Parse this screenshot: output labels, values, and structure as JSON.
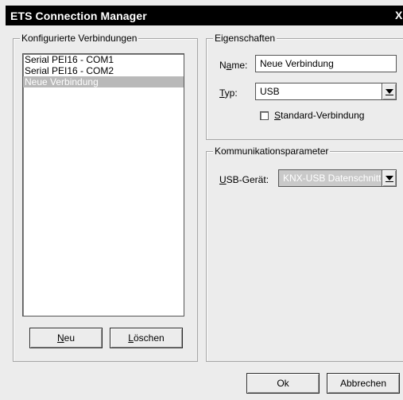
{
  "window": {
    "title": "ETS Connection Manager",
    "close_glyph": "X"
  },
  "connections": {
    "legend": "Konfigurierte Verbindungen",
    "items": [
      {
        "label": "Serial PEI16 - COM1",
        "selected": false
      },
      {
        "label": "Serial PEI16 - COM2",
        "selected": false
      },
      {
        "label": "Neue Verbindung",
        "selected": true
      }
    ],
    "new_button": {
      "pre": "",
      "key": "N",
      "post": "eu"
    },
    "delete_button": {
      "pre": "",
      "key": "L",
      "post": "öschen"
    }
  },
  "properties": {
    "legend": "Eigenschaften",
    "name_label": {
      "pre": "N",
      "key": "a",
      "post": "me:"
    },
    "name_value": "Neue Verbindung",
    "type_label": {
      "pre": "",
      "key": "T",
      "post": "yp:"
    },
    "type_value": "USB",
    "standard_checkbox": {
      "checked": false,
      "label": {
        "pre": "",
        "key": "S",
        "post": "tandard-Verbindung"
      }
    }
  },
  "comm_params": {
    "legend": "Kommunikationsparameter",
    "device_label": {
      "pre": "",
      "key": "U",
      "post": "SB-Gerät:"
    },
    "device_value": "KNX-USB Datenschnittstelle",
    "device_disabled": true
  },
  "footer": {
    "ok_label": "Ok",
    "cancel_label": "Abbrechen"
  }
}
